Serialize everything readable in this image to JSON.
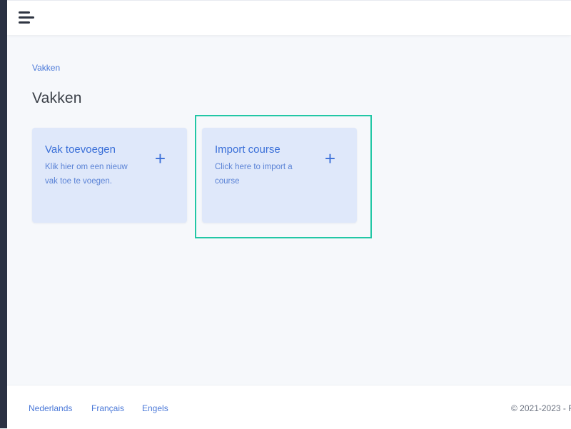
{
  "colors": {
    "sidebar": "#2a3143",
    "accent": "#3a6fd8",
    "card_bg": "#dfe8fa",
    "highlight": "#22c7a5",
    "background": "#f6f8fb"
  },
  "header": {
    "menu_icon": "hamburger-menu-icon"
  },
  "breadcrumb": {
    "items": [
      "Vakken"
    ]
  },
  "page": {
    "title": "Vakken"
  },
  "cards": [
    {
      "title": "Vak toevoegen",
      "description": "Klik hier om een nieuw vak toe te voegen.",
      "icon": "plus-icon",
      "icon_glyph": "+"
    },
    {
      "title": "Import course",
      "description": "Click here to import a course",
      "icon": "plus-icon",
      "icon_glyph": "+"
    }
  ],
  "footer": {
    "languages": [
      "Nederlands",
      "Français",
      "Engels"
    ],
    "copyright": "© 2021-2023 - F"
  }
}
